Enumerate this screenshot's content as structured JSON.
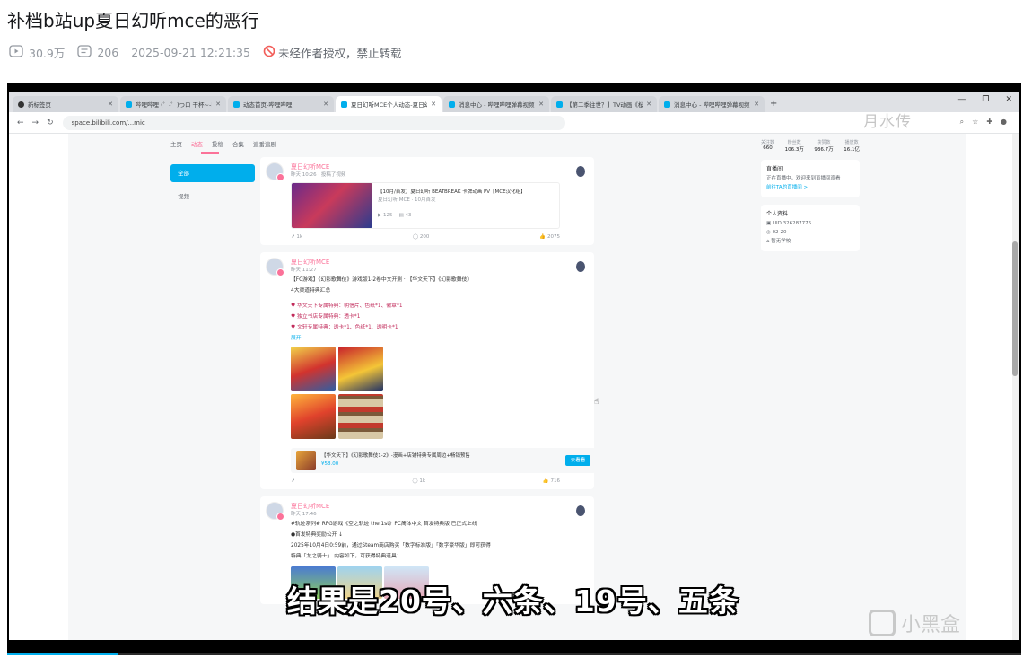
{
  "page": {
    "title": "补档b站up夏日幻听mce的恶行",
    "views": "30.9万",
    "danmaku": "206",
    "datetime": "2025-09-21 12:21:35",
    "copyright": "未经作者授权，禁止转载"
  },
  "player": {
    "progress_fraction": 0.11,
    "subtitle": "结果是20号、六条、19号、五条",
    "watermark_top": "月水传",
    "watermark_bottom": "小黑盒",
    "accent": "#00aeec"
  },
  "browser": {
    "tabs": [
      {
        "label": "新标签页",
        "active": false,
        "icon": "circle-icon"
      },
      {
        "label": "哔哩哔哩 (゜-゜)つロ 干杯~-b",
        "active": false,
        "icon": "bilibili-icon"
      },
      {
        "label": "动态首页-哔哩哔哩",
        "active": false,
        "icon": "bilibili-icon"
      },
      {
        "label": "夏日幻听MCE个人动态-夏日幻",
        "active": true,
        "icon": "bilibili-icon"
      },
      {
        "label": "消息中心 - 哔哩哔哩弹幕视频",
        "active": false,
        "icon": "bilibili-icon"
      },
      {
        "label": "【第二季往世？】TV动画《桜",
        "active": false,
        "icon": "bilibili-icon"
      },
      {
        "label": "消息中心 - 哔哩哔哩弹幕视频网",
        "active": false,
        "icon": "bilibili-icon"
      }
    ],
    "new_tab": "+",
    "url": "space.bilibili.com/...mic"
  },
  "site": {
    "subnav": [
      "主页",
      "动态",
      "投稿",
      "合集",
      "追番追剧"
    ],
    "left_menu": [
      "全部",
      "视频"
    ],
    "posts": [
      {
        "author": "夏日幻听MCE",
        "time": "昨天 10:26 · 投稿了视频",
        "video_title": "【10月/首发】夏日幻听 BEATBREAK 卡牌动画 PV【MCE汉化组】",
        "video_sub": "夏日幻听 MCE · 10月首发",
        "plays": "125",
        "danmu": "43",
        "comments": "1k",
        "reposts": "200",
        "likes": "2075"
      },
      {
        "author": "夏日幻听MCE",
        "time": "昨天 11:27",
        "lines": [
          "【FC游戏】《幻影歌舞伎》游戏版1-2卷中文开测 · 【华文天下】《幻影歌舞伎》",
          "4大渠道特典汇总",
          "♥ 华文天下专属特典：明信片、色纸*1、徽章*1",
          "♥ 独立书店专属特典：透卡*1",
          "♥ 文轩专属特典：透卡*1、色纸*1、透明卡*1",
          "展开"
        ],
        "share_title": "【华文天下】《幻影歌舞伎1-2》-漫画+店铺特典专属周边+畅销预售",
        "share_price": "¥58.00",
        "share_button": "去看看",
        "comments": "1k",
        "likes": "716"
      },
      {
        "author": "夏日幻听MCE",
        "time": "昨天 17:46",
        "lines": [
          "#轨迹系列# RPG游戏《空之轨迹 the 1st》PC简体中文 首发特典版 已正式上线",
          "●首发特典奖励公开 ↓",
          "2025年10月4日0:59前，通过Steam商店购买「数字标准版」「数字豪华版」即可获得",
          "特典「龙之骑士」 内容如下，可获得特典道具："
        ]
      }
    ],
    "right": {
      "stats": [
        {
          "label": "关注数",
          "value": "660"
        },
        {
          "label": "粉丝数",
          "value": "106.3万"
        },
        {
          "label": "获赞数",
          "value": "936.7万"
        },
        {
          "label": "播放数",
          "value": "16.1亿"
        }
      ],
      "notice_title": "直播间",
      "notice_text": "正在直播中，欢迎来到直播间观看",
      "notice_link": "前往TA的直播间 >",
      "profile_title": "个人资料",
      "uid": "UID 326287776",
      "birthday": "02-20",
      "school": "暂无学校"
    }
  }
}
